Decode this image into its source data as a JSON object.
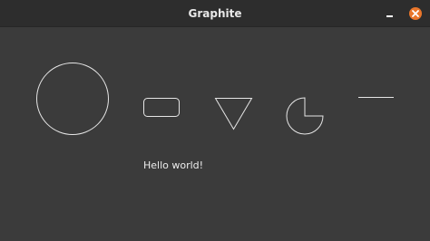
{
  "window": {
    "title": "Graphite",
    "accent_color": "#e9762b",
    "background_color": "#3b3b3b",
    "titlebar_color": "#2d2d2d"
  },
  "controls": {
    "minimize_icon": "minimize-icon",
    "close_icon": "close-icon"
  },
  "canvas": {
    "shape_stroke_color": "#e6e6e6",
    "shapes": [
      "circle",
      "rounded-rectangle",
      "triangle",
      "pie",
      "line"
    ],
    "pie_fill_fraction": 0.75,
    "text": "Hello world!"
  }
}
